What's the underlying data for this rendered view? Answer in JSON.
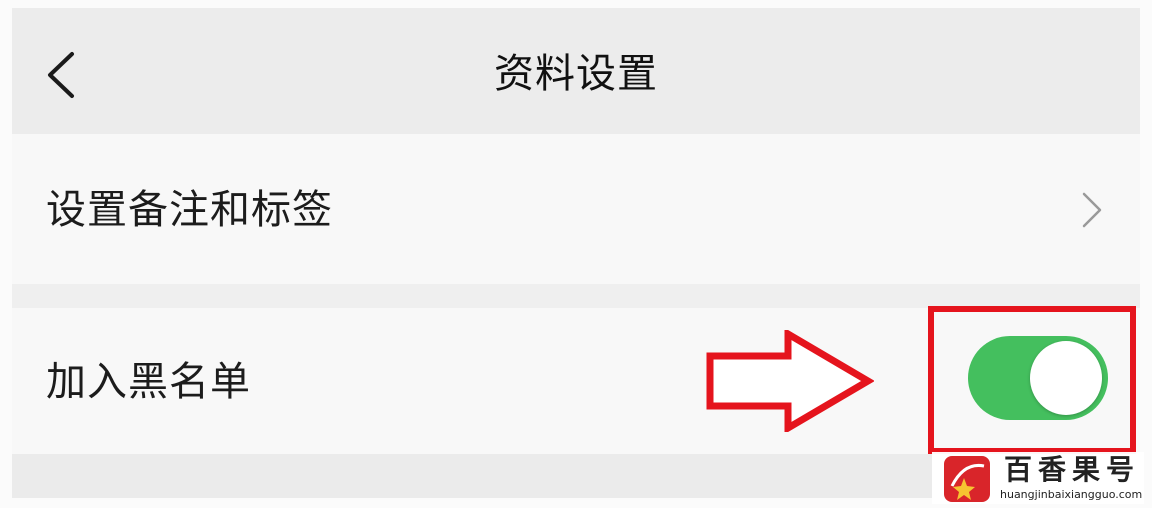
{
  "header": {
    "title": "资料设置"
  },
  "settings": {
    "items": [
      {
        "label": "设置备注和标签"
      },
      {
        "label": "加入黑名单",
        "toggle_on": true
      }
    ]
  },
  "colors": {
    "toggle_green": "#44bf5e",
    "highlight_red": "#e5141d",
    "background": "#efefef"
  },
  "watermark": {
    "title": "百香果号",
    "url": "huangjinbaixiangguo.com"
  }
}
